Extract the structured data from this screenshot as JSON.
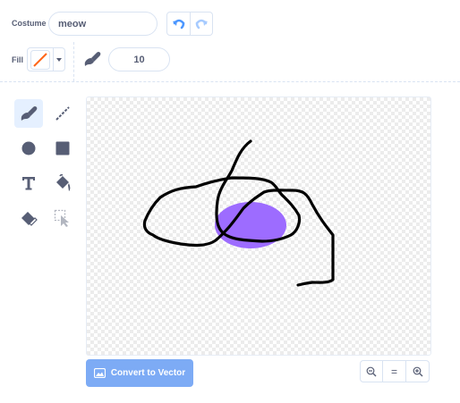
{
  "costume": {
    "label": "Costume",
    "name_value": "meow"
  },
  "fill": {
    "label": "Fill",
    "color": "#ff661a"
  },
  "brush": {
    "size_value": "10"
  },
  "colors": {
    "selected_tool_bg": "#e5f0ff",
    "fill_shape": "#9966ff",
    "accent": "#4c97ff",
    "convert_button": "#855cd6"
  },
  "canvas": {
    "background": "checkerboard",
    "drawn_shapes": [
      "black freehand scribble",
      "purple filled ellipse"
    ]
  },
  "tools": [
    {
      "name": "brush",
      "icon": "brush-icon",
      "selected": true
    },
    {
      "name": "line",
      "icon": "line-icon",
      "selected": false
    },
    {
      "name": "circle",
      "icon": "circle-icon",
      "selected": false
    },
    {
      "name": "rectangle",
      "icon": "rectangle-icon",
      "selected": false
    },
    {
      "name": "text",
      "icon": "text-icon",
      "selected": false
    },
    {
      "name": "fill",
      "icon": "fill-bucket-icon",
      "selected": false
    },
    {
      "name": "eraser",
      "icon": "eraser-icon",
      "selected": false
    },
    {
      "name": "select",
      "icon": "select-icon",
      "selected": false
    }
  ],
  "convert": {
    "label": "Convert to Vector"
  },
  "zoom": {
    "reset_label": "="
  }
}
